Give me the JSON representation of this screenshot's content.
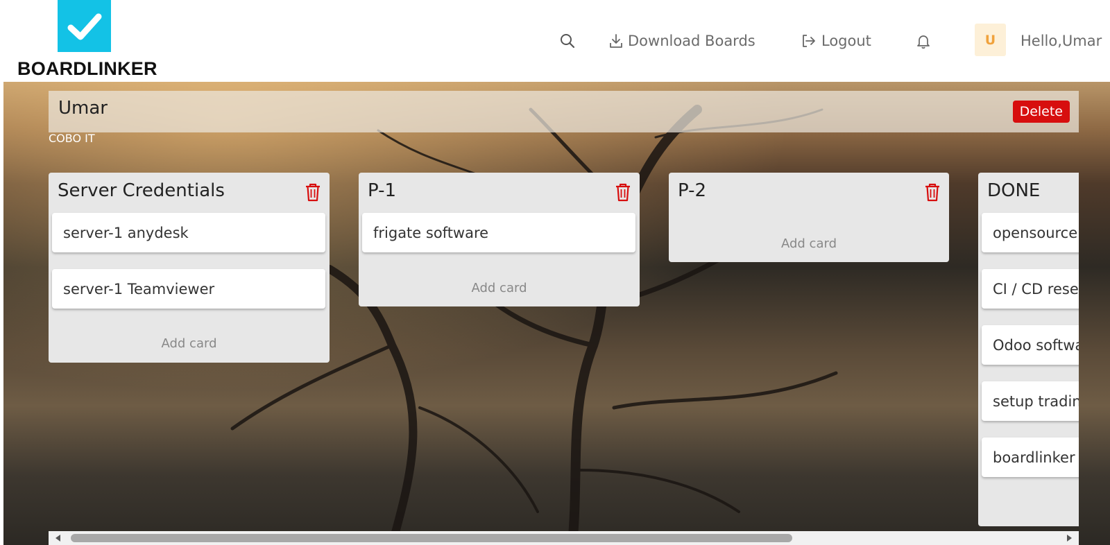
{
  "header": {
    "logo_text": "BOARDLINKER",
    "download_label": "Download Boards",
    "logout_label": "Logout",
    "avatar_initial": "U",
    "greeting": "Hello,Umar"
  },
  "board": {
    "title": "Umar",
    "delete_label": "Delete",
    "organization": "COBO IT"
  },
  "lists": [
    {
      "title": "Server Credentials",
      "cards": [
        "server-1 anydesk",
        "server-1 Teamviewer"
      ],
      "add_label": "Add card"
    },
    {
      "title": "P-1",
      "cards": [
        "frigate software"
      ],
      "add_label": "Add card"
    },
    {
      "title": "P-2",
      "cards": [],
      "add_label": "Add card"
    },
    {
      "title": "DONE",
      "cards": [
        "opensource",
        "CI / CD resea",
        "Odoo softwa",
        "setup tradin",
        "boardlinker"
      ]
    }
  ],
  "colors": {
    "brand": "#13c2e6",
    "danger": "#d70e0e",
    "avatar_bg": "#fdf0d8",
    "avatar_fg": "#f0a23c"
  }
}
